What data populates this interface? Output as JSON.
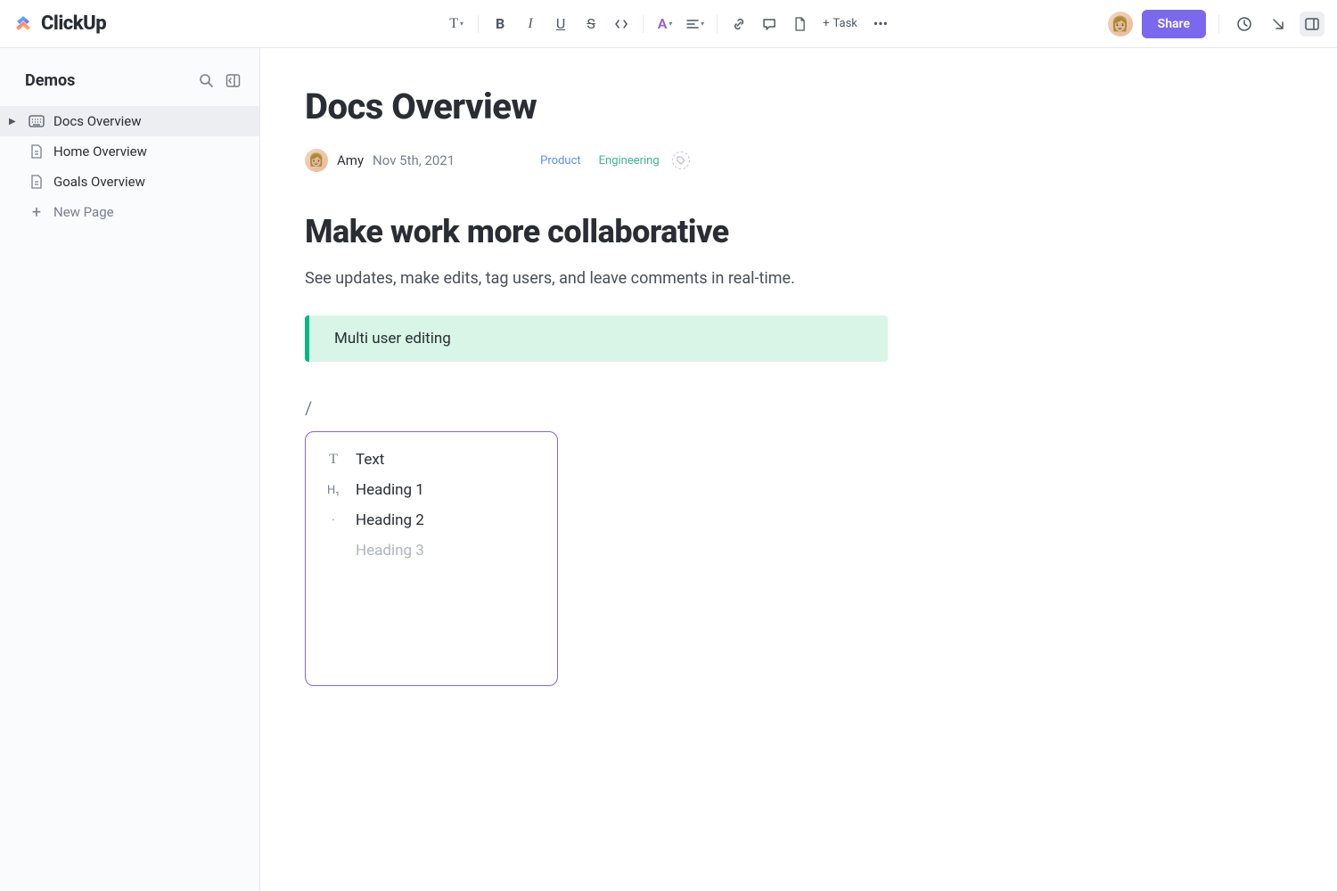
{
  "app": {
    "name": "ClickUp"
  },
  "toolbar": {
    "task_label": "Task",
    "share_label": "Share"
  },
  "sidebar": {
    "title": "Demos",
    "items": [
      {
        "label": "Docs Overview",
        "active": true
      },
      {
        "label": "Home Overview",
        "active": false
      },
      {
        "label": "Goals Overview",
        "active": false
      }
    ],
    "new_page_label": "New Page"
  },
  "doc": {
    "title": "Docs Overview",
    "author": "Amy",
    "date": "Nov 5th, 2021",
    "tags": [
      {
        "label": "Product",
        "kind": "product"
      },
      {
        "label": "Engineering",
        "kind": "eng"
      }
    ],
    "heading": "Make work more collaborative",
    "paragraph": "See updates, make edits, tag users, and leave comments in real-time.",
    "callout": "Multi user editing",
    "slash_char": "/"
  },
  "slash_menu": {
    "items": [
      {
        "icon": "T",
        "label": "Text"
      },
      {
        "icon": "H₁",
        "label": "Heading 1"
      },
      {
        "icon": "·",
        "label": "Heading 2"
      },
      {
        "icon": "",
        "label": "Heading 3",
        "dim": true
      }
    ]
  }
}
